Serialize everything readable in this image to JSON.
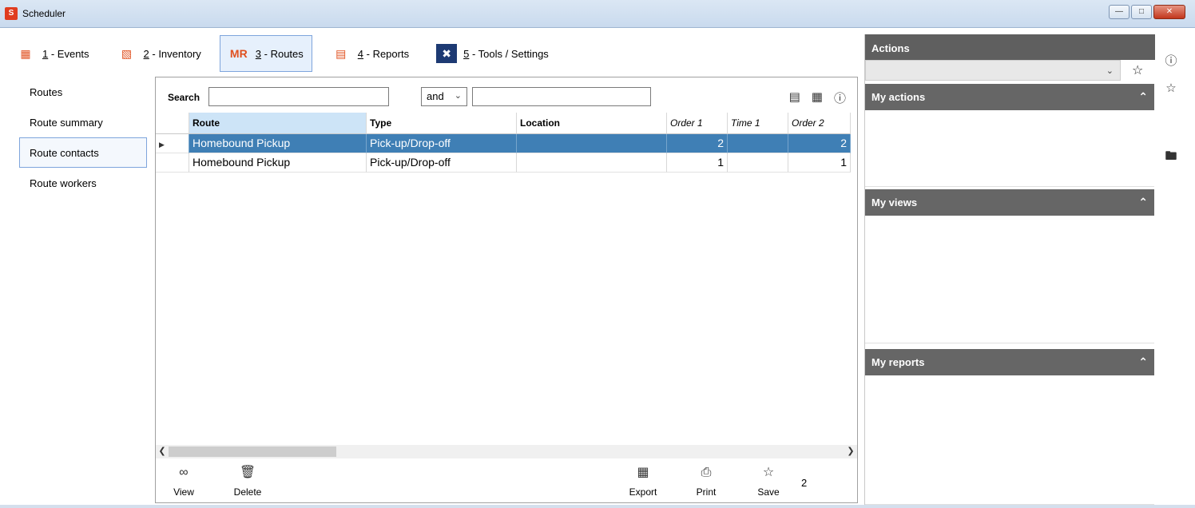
{
  "window": {
    "title": "Scheduler",
    "app_icon_label": "S"
  },
  "modules": [
    {
      "key": "1",
      "rest": " - Events",
      "icon": "events-icon"
    },
    {
      "key": "2",
      "rest": " - Inventory",
      "icon": "inventory-icon"
    },
    {
      "key": "3",
      "rest": " - Routes",
      "icon": "routes-icon",
      "icon_text": "MR",
      "active": true
    },
    {
      "key": "4",
      "rest": " - Reports",
      "icon": "reports-icon"
    },
    {
      "key": "5",
      "rest": " - Tools / Settings",
      "icon": "tools-icon"
    }
  ],
  "leftnav": [
    {
      "label": "Routes"
    },
    {
      "label": "Route summary"
    },
    {
      "label": "Route contacts",
      "active": true
    },
    {
      "label": "Route workers"
    }
  ],
  "search": {
    "label": "Search",
    "value": "",
    "operator": "and",
    "value2": ""
  },
  "grid": {
    "columns": [
      "Route",
      "Type",
      "Location",
      "Order 1",
      "Time 1",
      "Order 2"
    ],
    "rows": [
      {
        "route": "Homebound Pickup",
        "type": "Pick-up/Drop-off",
        "location": "",
        "order1": "2",
        "time1": "",
        "order2": "2",
        "selected": true
      },
      {
        "route": "Homebound Pickup",
        "type": "Pick-up/Drop-off",
        "location": "",
        "order1": "1",
        "time1": "",
        "order2": "1"
      }
    ]
  },
  "toolbar": {
    "view": "View",
    "delete": "Delete",
    "export": "Export",
    "print": "Print",
    "save": "Save",
    "count": "2"
  },
  "actions": {
    "title": "Actions",
    "combo_value": "",
    "my_actions": "My actions",
    "my_views": "My views",
    "my_reports": "My reports"
  },
  "colors": {
    "selection": "#3f7fb5",
    "section_header": "#666666",
    "accent_orange": "#e0501f"
  }
}
